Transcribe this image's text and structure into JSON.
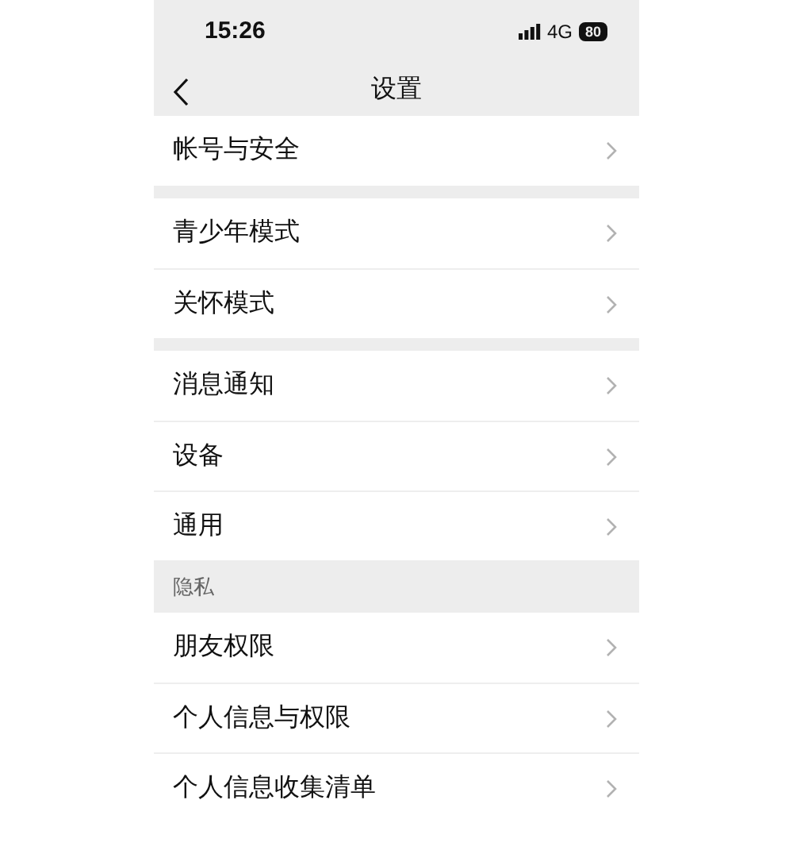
{
  "status_bar": {
    "time": "15:26",
    "network": "4G",
    "battery": "80"
  },
  "nav": {
    "title": "设置"
  },
  "groups": [
    {
      "items": [
        {
          "label": "帐号与安全"
        }
      ]
    },
    {
      "items": [
        {
          "label": "青少年模式"
        },
        {
          "label": "关怀模式"
        }
      ]
    },
    {
      "items": [
        {
          "label": "消息通知"
        },
        {
          "label": "设备"
        },
        {
          "label": "通用"
        }
      ]
    },
    {
      "header": "隐私",
      "items": [
        {
          "label": "朋友权限"
        },
        {
          "label": "个人信息与权限"
        },
        {
          "label": "个人信息收集清单"
        }
      ]
    }
  ]
}
